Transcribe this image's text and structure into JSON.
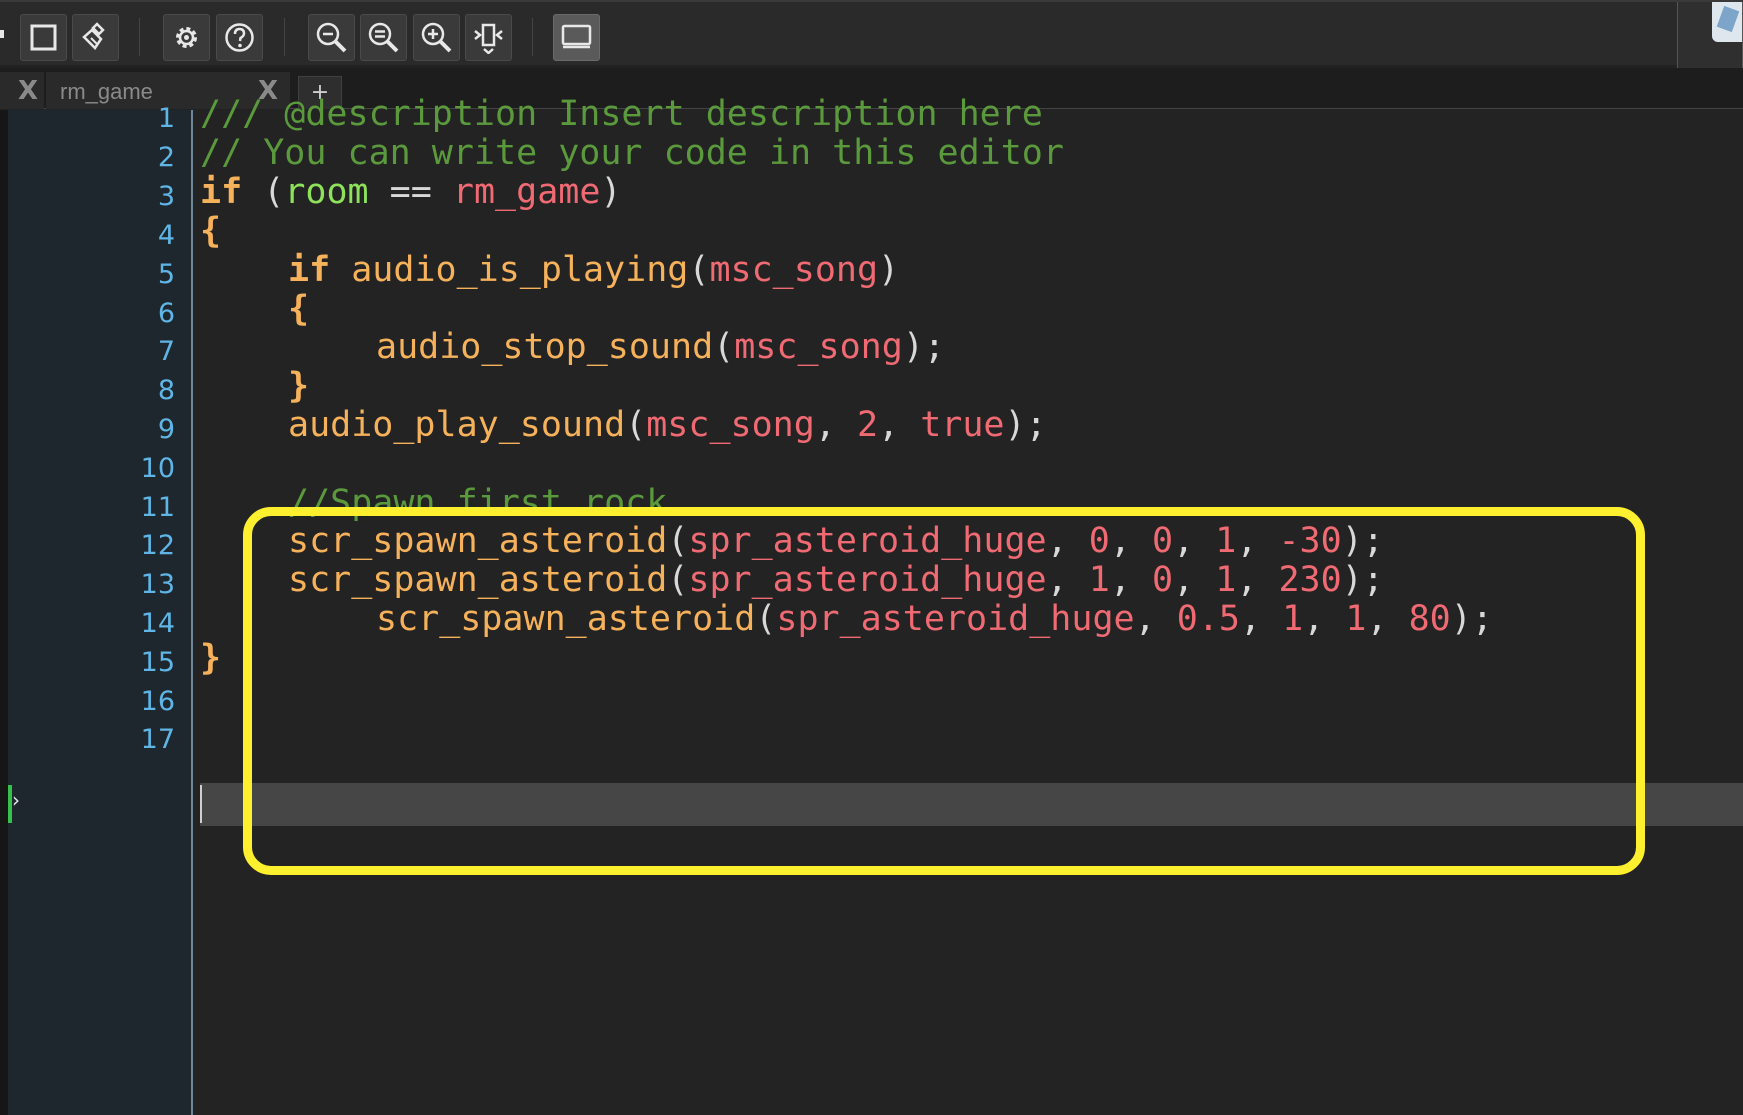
{
  "toolbar": {
    "buttons": [
      {
        "name": "stop-icon"
      },
      {
        "name": "clean-brush-icon"
      },
      {
        "name": "settings-gear-icon"
      },
      {
        "name": "help-icon"
      },
      {
        "name": "zoom-out-icon"
      },
      {
        "name": "zoom-reset-icon"
      },
      {
        "name": "zoom-in-icon"
      },
      {
        "name": "fit-view-icon"
      },
      {
        "name": "display-monitor-icon"
      }
    ]
  },
  "tabs": {
    "items": [
      {
        "label": "",
        "close": "X"
      },
      {
        "label": "rm_game",
        "close": "X"
      }
    ],
    "add": "+"
  },
  "editor": {
    "line_numbers": [
      "1",
      "2",
      "3",
      "4",
      "5",
      "6",
      "7",
      "8",
      "9",
      "10",
      "11",
      "12",
      "13",
      "14",
      "15",
      "16",
      "17"
    ],
    "lines": {
      "l1": "/// @description Insert description here",
      "l2": "// You can write your code in this editor",
      "l3": {
        "kw": "if",
        "open": " (",
        "var": "room",
        "op": " == ",
        "res": "rm_game",
        "close": ")"
      },
      "l4": "{",
      "l5": {
        "kw": "if",
        "fn": " audio_is_playing",
        "open": "(",
        "res": "msc_song",
        "close": ")"
      },
      "l6": "{",
      "l7": {
        "fn": "audio_stop_sound",
        "open": "(",
        "res": "msc_song",
        "close": ");"
      },
      "l8": "}",
      "l9": {
        "fn": "audio_play_sound",
        "open": "(",
        "res": "msc_song",
        "sep1": ", ",
        "n1": "2",
        "sep2": ", ",
        "n2": "true",
        "close": ");"
      },
      "l11": "//Spawn first rock",
      "l12": {
        "fn": "scr_spawn_asteroid",
        "open": "(",
        "res": "spr_asteroid_huge",
        "sep1": ", ",
        "n1": "0",
        "sep2": ", ",
        "n2": "0",
        "sep3": ", ",
        "n3": "1",
        "sep4": ", ",
        "n4": "-30",
        "close": ");"
      },
      "l13": {
        "fn": "scr_spawn_asteroid",
        "open": "(",
        "res": "spr_asteroid_huge",
        "sep1": ", ",
        "n1": "1",
        "sep2": ", ",
        "n2": "0",
        "sep3": ", ",
        "n3": "1",
        "sep4": ", ",
        "n4": "230",
        "close": ");"
      },
      "l14": {
        "fn": "scr_spawn_asteroid",
        "open": "(",
        "res": "spr_asteroid_huge",
        "sep1": ", ",
        "n1": "0.5",
        "sep2": ", ",
        "n2": "1",
        "sep3": ", ",
        "n3": "1",
        "sep4": ", ",
        "n4": "80",
        "close": ");"
      },
      "l15": "}"
    }
  },
  "colors": {
    "comment": "#5b9a3c",
    "keyword": "#f6b15b",
    "variable": "#8ee25a",
    "resource": "#f06a73",
    "line_number": "#5fb6e6",
    "highlight": "#fff02f"
  }
}
